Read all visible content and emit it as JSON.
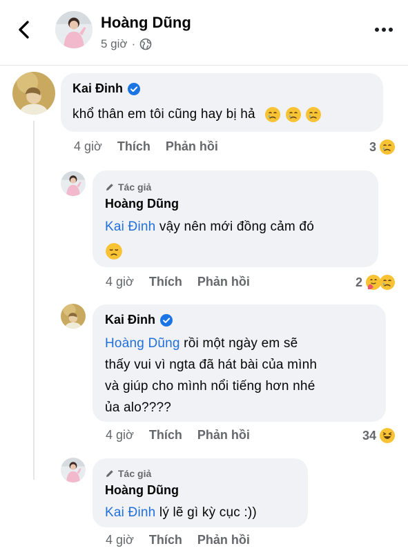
{
  "header": {
    "name": "Hoàng Dũng",
    "time": "5 giờ",
    "separator": "·"
  },
  "labels": {
    "author_badge": "Tác giả"
  },
  "comments": [
    {
      "author": "Kai Đinh",
      "text": "khổ thân em tôi cũng hay bị hả",
      "time": "4 giờ",
      "like": "Thích",
      "reply": "Phản hồi",
      "reaction_count": "3"
    },
    {
      "author": "Hoàng Dũng",
      "mention": "Kai Đinh",
      "text": " vậy nên mới đồng cảm đó",
      "time": "4 giờ",
      "like": "Thích",
      "reply": "Phản hồi",
      "reaction_count": "2"
    },
    {
      "author": "Kai Đinh",
      "mention": "Hoàng Dũng",
      "text_line1": " rồi một ngày em sẽ",
      "text_line2": "thấy vui vì ngta đã hát bài của mình",
      "text_line3": "và giúp cho mình nổi tiếng hơn nhé",
      "text_line4": "ủa alo????",
      "time": "4 giờ",
      "like": "Thích",
      "reply": "Phản hồi",
      "reaction_count": "34"
    },
    {
      "author": "Hoàng Dũng",
      "mention": "Kai Đinh",
      "text": " lý lẽ gì kỳ cục :))",
      "time": "4 giờ",
      "like": "Thích",
      "reply": "Phản hồi"
    }
  ],
  "colors": {
    "mention": "#216fdb",
    "verified": "#1b74e4",
    "emoji": "#f7c234"
  }
}
